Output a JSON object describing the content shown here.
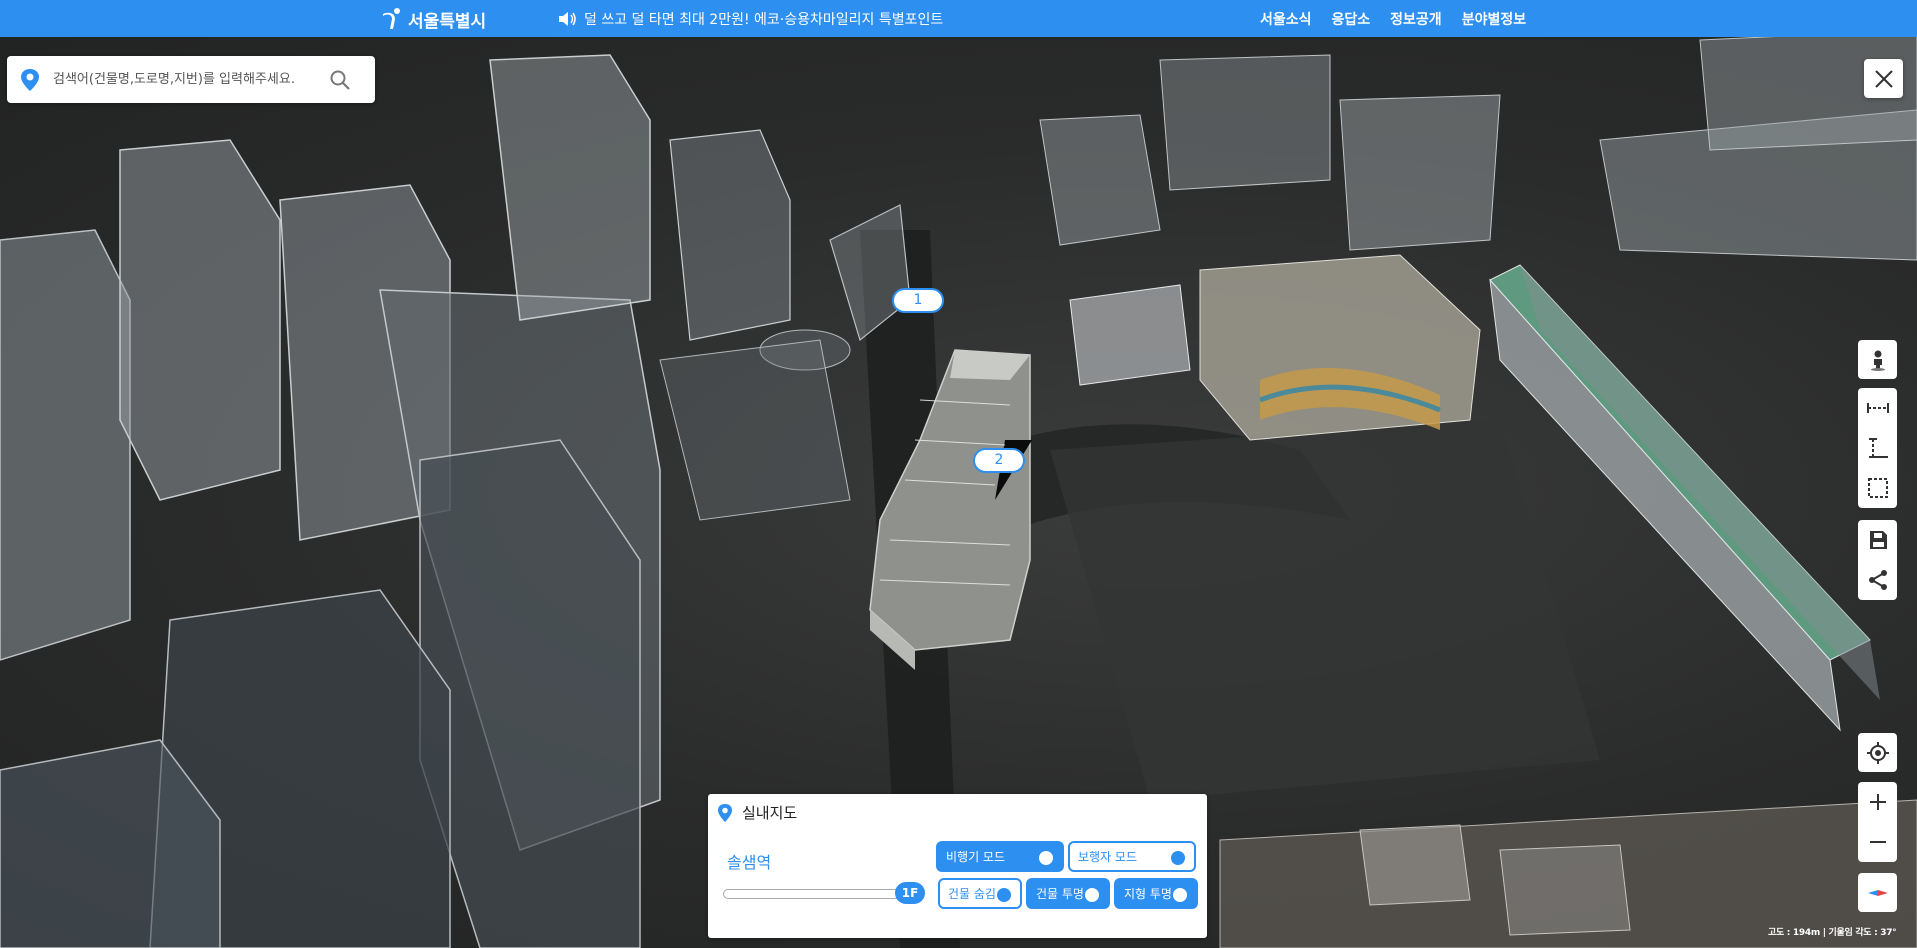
{
  "header": {
    "logo_text": "서울특별시",
    "notice": "덜 쓰고 덜 타면 최대 2만원! 에코·승용차마일리지 특별포인트",
    "nav": [
      "서울소식",
      "응답소",
      "정보공개",
      "분야별정보"
    ],
    "brand_color": "#2d8ff0"
  },
  "search": {
    "placeholder": "검색어(건물명,도로명,지번)를 입력해주세요.",
    "value": ""
  },
  "markers": [
    "1",
    "2"
  ],
  "tools": {
    "icons": [
      "person-icon",
      "distance-icon",
      "height-icon",
      "area-icon",
      "save-icon",
      "share-icon",
      "location-icon",
      "zoom-in-icon",
      "zoom-out-icon",
      "compass-icon"
    ]
  },
  "indoor": {
    "title": "실내지도",
    "station": "솔샘역",
    "floor": "1F",
    "modes": {
      "airplane": "비행기 모드",
      "walker": "보행자 모드",
      "hide_building": "건물 숨김",
      "building_transparent": "건물 투명",
      "terrain_transparent": "지형 투명"
    }
  },
  "status_text": "고도 : 194m | 기울임 각도 : 37°"
}
